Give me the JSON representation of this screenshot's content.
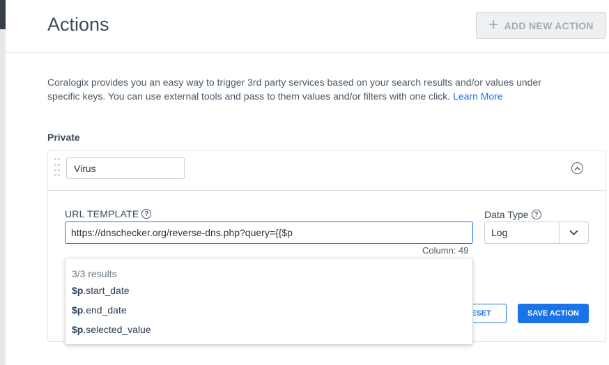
{
  "header": {
    "title": "Actions",
    "add_button_label": "ADD NEW ACTION"
  },
  "description": {
    "text": "Coralogix provides you an easy way to trigger 3rd party services based on your search results and/or values under specific keys. You can use external tools and pass to them values and/or filters with one click.",
    "learn_more": "Learn More"
  },
  "section": {
    "label": "Private"
  },
  "action": {
    "name_value": "Virus",
    "url_template_label": "URL TEMPLATE",
    "url_value": "https://dnschecker.org/reverse-dns.php?query={{$p",
    "column_info": "Column: 49",
    "data_type_label": "Data Type",
    "data_type_value": "Log",
    "reset_label": "RESET",
    "save_label": "SAVE ACTION"
  },
  "autocomplete": {
    "count": "3/3 results",
    "items": [
      {
        "prefix": "$p",
        "suffix": ".start_date"
      },
      {
        "prefix": "$p",
        "suffix": ".end_date"
      },
      {
        "prefix": "$p",
        "suffix": ".selected_value"
      }
    ]
  },
  "colors": {
    "accent": "#1a73e8",
    "text": "#3b4a5a",
    "border": "#dfe3e7"
  },
  "icons": {
    "add": "plus-icon",
    "collapse": "chevron-up-circle-icon",
    "help": "question-circle-icon",
    "dropdown": "chevron-down-icon",
    "drag": "drag-handle-icon"
  }
}
